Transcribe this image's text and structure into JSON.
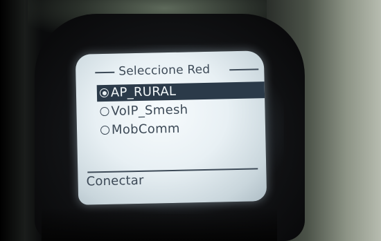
{
  "screen": {
    "title": "Seleccione Red",
    "networks": [
      {
        "label": "AP_RURAL",
        "selected": true
      },
      {
        "label": "VoIP_Smesh",
        "selected": false
      },
      {
        "label": "MobComm",
        "selected": false
      }
    ],
    "softkey_label": "Conectar"
  },
  "colors": {
    "screen_background": "#eef4f7",
    "screen_text": "#3d4a57",
    "highlight": "#2b3a49"
  }
}
